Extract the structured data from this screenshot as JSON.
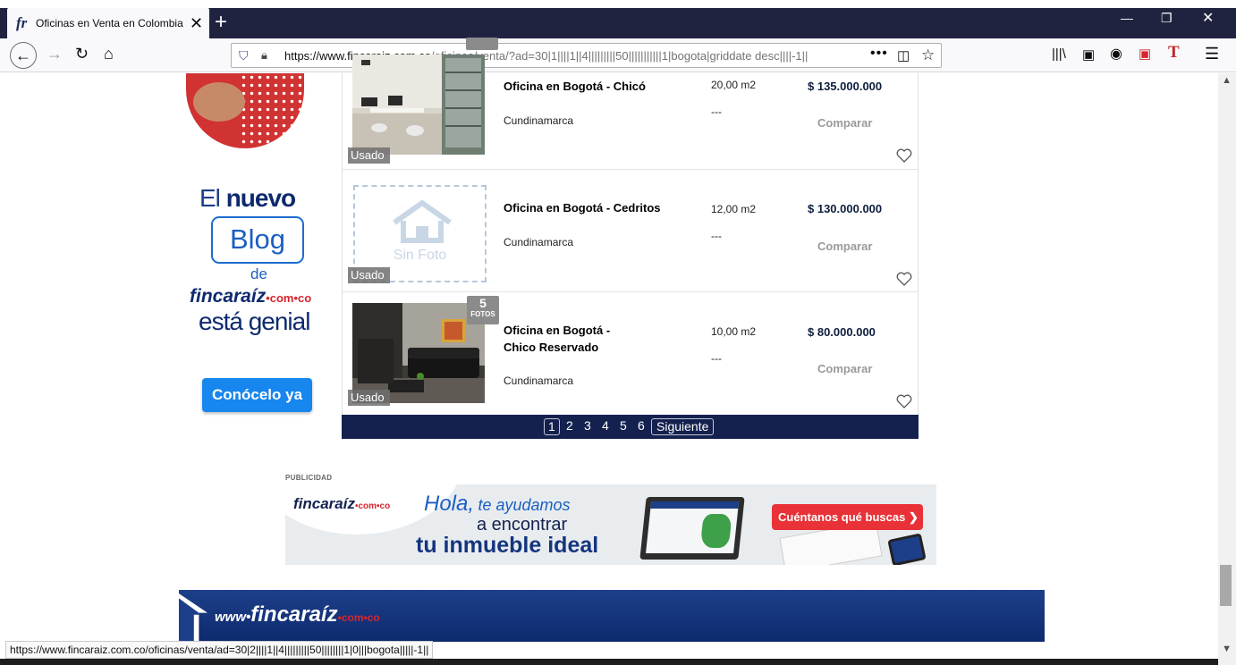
{
  "browser": {
    "tab_title": "Oficinas en Venta en Colombia",
    "tab_logo": "fr",
    "url_domain": "https://www.fincaraiz.com.co",
    "url_path": "/oficinas/venta/?ad=30|1||||1||4|||||||||50|||||||||||1|bogota|griddate desc||||-1||",
    "status_url": "https://www.fincaraiz.com.co/oficinas/venta/ad=30|2||||1||4|||||||||50||||||||1|0|||bogota|||||-1||"
  },
  "blog_ad": {
    "line1_pre": "El",
    "line1_bold": "nuevo",
    "box": "Blog",
    "de": "de",
    "brand": "fincaraíz",
    "brand_suffix": "•com•co",
    "line4": "está genial",
    "button": "Conócelo ya"
  },
  "listings": [
    {
      "title": "Oficina en Bogotá - Chicó",
      "region": "Cundinamarca",
      "area": "20,00 m2",
      "rooms": "---",
      "price": "$ 135.000.000",
      "compare": "Comparar",
      "condition": "Usado",
      "photo": "office-photo"
    },
    {
      "title": "Oficina en Bogotá - Cedritos",
      "region": "Cundinamarca",
      "area": "12,00 m2",
      "rooms": "---",
      "price": "$ 130.000.000",
      "compare": "Comparar",
      "condition": "Usado",
      "no_photo_text": "Sin Foto"
    },
    {
      "title_l1": "Oficina en Bogotá -",
      "title_l2": "Chico Reservado",
      "region": "Cundinamarca",
      "area": "10,00 m2",
      "rooms": "---",
      "price": "$ 80.000.000",
      "compare": "Comparar",
      "condition": "Usado",
      "photo_count": "5",
      "photo_count_label": "FOTOS"
    }
  ],
  "pagination": {
    "pages": [
      "1",
      "2",
      "3",
      "4",
      "5",
      "6"
    ],
    "current": "1",
    "next": "Siguiente"
  },
  "publicidad": {
    "label": "PUBLICIDAD",
    "brand": "fincaraíz",
    "brand_suffix": "•com•co",
    "hola": "Hola,",
    "ayudamos": "te ayudamos",
    "line2": "a encontrar",
    "line3": "tu inmueble ideal",
    "cta": "Cuéntanos qué buscas"
  },
  "footer": {
    "prefix": "www•",
    "brand": "fincaraíz",
    "suffix": "•com•co"
  },
  "colors": {
    "brand_navy": "#14214f",
    "brand_blue": "#1b5fc2",
    "cta_red": "#e83238",
    "button_blue": "#1786ee"
  }
}
